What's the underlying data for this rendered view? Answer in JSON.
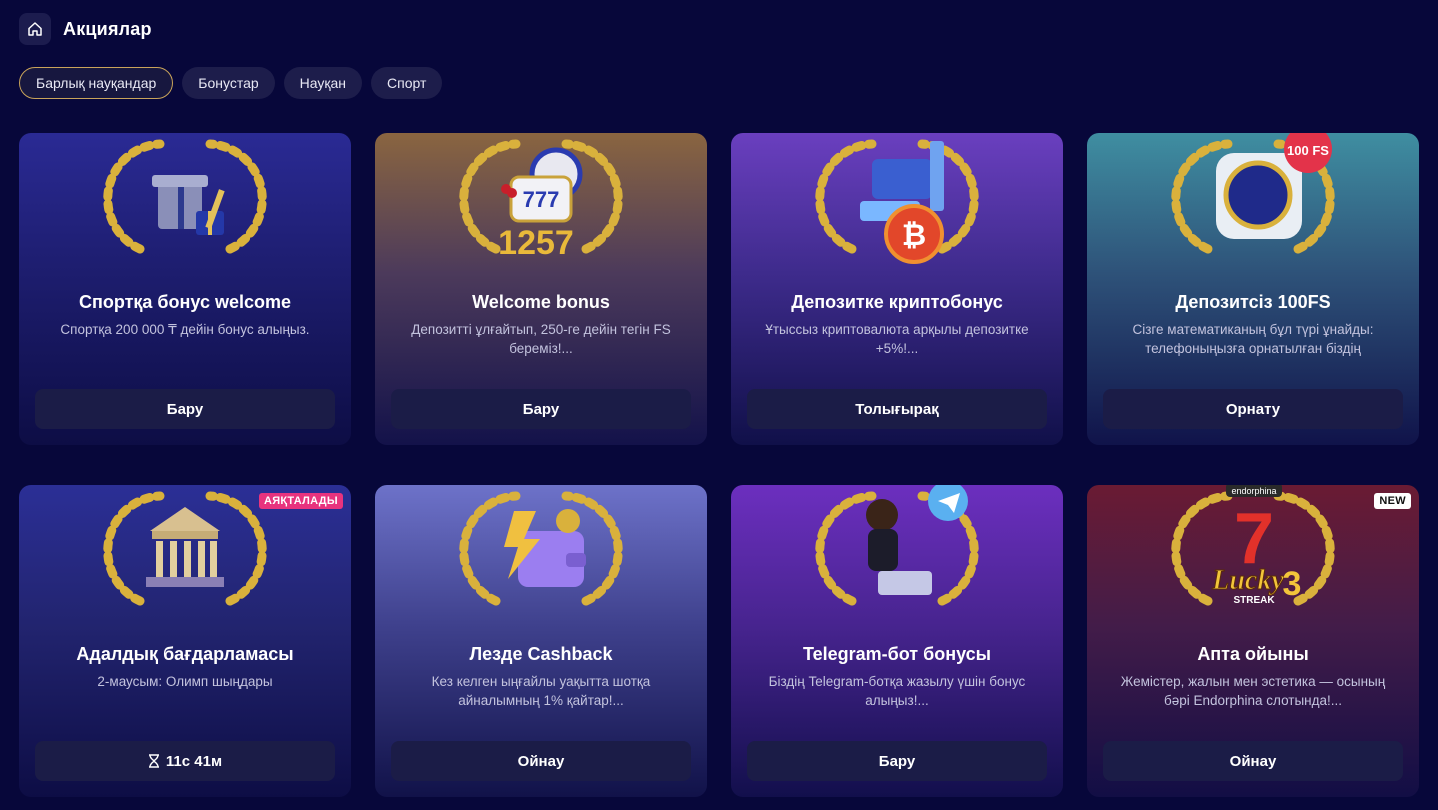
{
  "header": {
    "title": "Акциялар",
    "home_icon": "home-icon"
  },
  "filters": [
    {
      "label": "Барлық науқандар",
      "active": true
    },
    {
      "label": "Бонустар",
      "active": false
    },
    {
      "label": "Науқан",
      "active": false
    },
    {
      "label": "Спорт",
      "active": false
    }
  ],
  "cards": [
    {
      "title": "Спортқа бонус welcome",
      "description": "Спортқа 200 000 ₸ дейін бонус алыңыз.",
      "button": "Бару",
      "icon": "gift-box-icon",
      "theme": "blue"
    },
    {
      "title": "Welcome bonus",
      "description": "Депозитті ұлғайтып, 250-ге дейін тегін FS береміз!...",
      "button": "Бару",
      "icon": "slot-machine-icon",
      "theme": "gold"
    },
    {
      "title": "Депозитке криптобонус",
      "description": "Ұтыссыз криптовалюта арқылы депозитке +5%!...",
      "button": "Толығырақ",
      "icon": "bitcoin-icon",
      "theme": "violet"
    },
    {
      "title": "Депозитсіз 100FS",
      "description": "Сізге математиканың бұл түрі ұнайды: телефоныңызға орнатылған біздің қосымша...",
      "button": "Орнату",
      "icon": "app-icon",
      "badge_art": "100 FS",
      "theme": "teal"
    },
    {
      "title": "Адалдық бағдарламасы",
      "description": "2-маусым: Олимп шыңдары",
      "button": "11с 41м",
      "button_icon": "hourglass-icon",
      "badge": "АЯҚТАЛАДЫ",
      "icon": "temple-icon",
      "theme": "navy"
    },
    {
      "title": "Лезде Cashback",
      "description": "Кез келген ыңғайлы уақытта шотқа айналымның 1% қайтар!...",
      "button": "Ойнау",
      "icon": "wallet-icon",
      "theme": "lavender"
    },
    {
      "title": "Telegram-бот бонусы",
      "description": "Біздің Telegram-ботқа жазылу үшін бонус алыңыз!...",
      "button": "Бару",
      "icon": "telegram-icon",
      "theme": "purple"
    },
    {
      "title": "Апта ойыны",
      "description": "Жемістер, жалын мен эстетика — осының бәрі Endorphina слотында!...",
      "button": "Ойнау",
      "badge": "NEW",
      "icon": "lucky-streak-icon",
      "art_text_top": "Lucky",
      "art_text_mid": "STREAK",
      "art_text_num": "3",
      "art_brand": "endorphina",
      "theme": "red"
    }
  ],
  "colors": {
    "page_bg": "#07073a",
    "chip_bg": "#1d1d4b",
    "active_border": "#c9a45a",
    "button_bg": "#1b1c47",
    "badge_pink": "#e8337e"
  }
}
